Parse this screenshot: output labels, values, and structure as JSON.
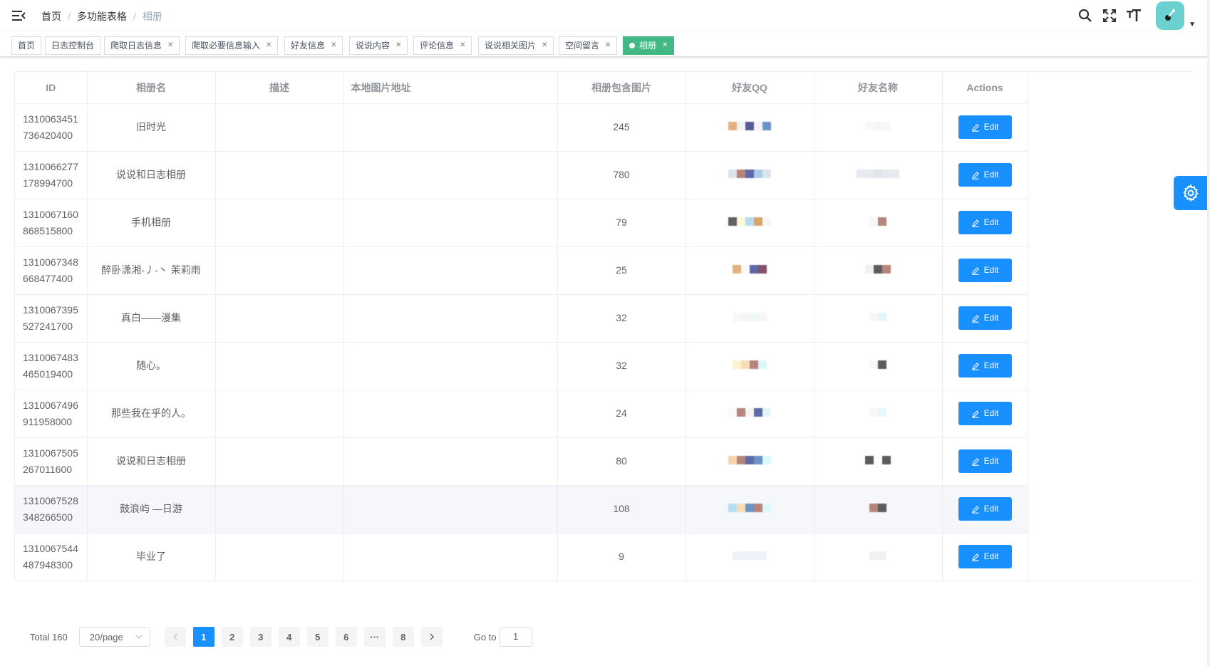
{
  "breadcrumb": [
    "首页",
    "多功能表格",
    "相册"
  ],
  "tags": [
    {
      "label": "首页",
      "closable": false
    },
    {
      "label": "日志控制台",
      "closable": false
    },
    {
      "label": "爬取日志信息",
      "closable": true
    },
    {
      "label": "爬取必要信息输入",
      "closable": true
    },
    {
      "label": "好友信息",
      "closable": true
    },
    {
      "label": "说说内容",
      "closable": true
    },
    {
      "label": "评论信息",
      "closable": true
    },
    {
      "label": "说说相关图片",
      "closable": true
    },
    {
      "label": "空间留言",
      "closable": true
    },
    {
      "label": "相册",
      "closable": true,
      "active": true
    }
  ],
  "table": {
    "headers": [
      "ID",
      "相册名",
      "描述",
      "本地图片地址",
      "相册包含图片",
      "好友QQ",
      "好友名称",
      "Actions"
    ],
    "rows": [
      {
        "id1": "1310063451",
        "id2": "736420400",
        "name": "旧时光",
        "desc": "",
        "path": "",
        "count": "245"
      },
      {
        "id1": "1310066277",
        "id2": "178994700",
        "name": "说说和日志相册",
        "desc": "",
        "path": "",
        "count": "780"
      },
      {
        "id1": "1310067160",
        "id2": "868515800",
        "name": "手机相册",
        "desc": "",
        "path": "",
        "count": "79"
      },
      {
        "id1": "1310067348",
        "id2": "668477400",
        "name": "醉卧潇湘-丿-丶 茉莉雨",
        "desc": "",
        "path": "",
        "count": "25"
      },
      {
        "id1": "1310067395",
        "id2": "527241700",
        "name": "真白——漫集",
        "desc": "",
        "path": "",
        "count": "32"
      },
      {
        "id1": "1310067483",
        "id2": "465019400",
        "name": "随心。",
        "desc": "",
        "path": "",
        "count": "32"
      },
      {
        "id1": "1310067496",
        "id2": "911958000",
        "name": "那些我在乎的人。",
        "desc": "",
        "path": "",
        "count": "24"
      },
      {
        "id1": "1310067505",
        "id2": "267011600",
        "name": "说说和日志相册",
        "desc": "",
        "path": "",
        "count": "80"
      },
      {
        "id1": "1310067528",
        "id2": "348266500",
        "name": "鼓浪屿 —日游",
        "desc": "",
        "path": "",
        "count": "108"
      },
      {
        "id1": "1310067544",
        "id2": "487948300",
        "name": "毕业了",
        "desc": "",
        "path": "",
        "count": "9"
      }
    ],
    "edit_label": "Edit"
  },
  "pagination": {
    "total": "Total 160",
    "page_size": "20/page",
    "pages": [
      "1",
      "2",
      "3",
      "4",
      "5",
      "6",
      "···",
      "8"
    ],
    "current": "1",
    "goto_label": "Go to",
    "goto_value": "1"
  },
  "colors": {
    "primary": "#1890ff",
    "active_tag": "#42b983",
    "border": "#ebeef5"
  }
}
